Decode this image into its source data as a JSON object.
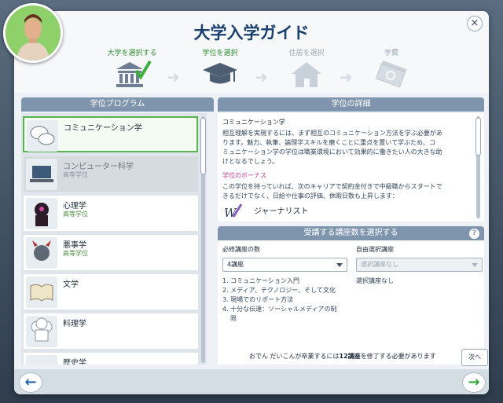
{
  "header": {
    "title": "大学入学ガイド",
    "close": "×"
  },
  "steps": [
    {
      "label": "大学を選択する",
      "state": "done"
    },
    {
      "label": "学位を選択",
      "state": "current"
    },
    {
      "label": "住居を選択",
      "state": "pending"
    },
    {
      "label": "学費",
      "state": "pending"
    }
  ],
  "degree_programs": {
    "heading": "学位プログラム",
    "items": [
      {
        "name": "コミュニケーション学",
        "sub": "",
        "icon": "speech-bubbles-icon"
      },
      {
        "name": "コンピューター科学",
        "sub": "高等学位",
        "icon": "laptop-icon"
      },
      {
        "name": "心理学",
        "sub": "高等学位",
        "icon": "head-silhouette-icon"
      },
      {
        "name": "悪事学",
        "sub": "高等学位",
        "icon": "devil-icon"
      },
      {
        "name": "文学",
        "sub": "",
        "icon": "book-icon"
      },
      {
        "name": "料理学",
        "sub": "",
        "icon": "chef-hat-icon"
      },
      {
        "name": "歴史学",
        "sub": "",
        "icon": "history-icon"
      }
    ]
  },
  "details": {
    "heading": "学位の詳細",
    "degree_name": "コミュニケーション学",
    "description_lines": [
      "相互理解を実現するには、まず相互のコミュニケーション方法を学ぶ必要があ",
      "ります。魅力、執筆、論理学スキルを磨くことに重点を置いて学ぶため、コ",
      "ミュニケーション学の学位は職業環境において効果的に働きたい人の大きな助",
      "けとなるでしょう。"
    ],
    "bonus_heading": "学位のボーナス",
    "bonus_lines": [
      "この学位を持っていれば、次のキャリアで契約金付きで中級職からスタートで",
      "きるだけでなく、日給や仕事の評価、休暇日数も上昇します："
    ],
    "career": "ジャーナリスト"
  },
  "course_select": {
    "heading": "受講する講座数を選択する",
    "help": "?",
    "required_label": "必修講座の数",
    "required_value": "4講座",
    "elective_label": "自由選択講座",
    "elective_value": "選択講座なし",
    "required_courses": [
      "1. コミュニケーション入門",
      "2. メディア、テクノロジー、そして文化",
      "3. 現場でのリポート方法",
      "4. 十分な伝達：ソーシャルメディアの制",
      "限"
    ],
    "elective_text": "選択講座なし",
    "footer_prefix": "おでん だいこんが卒業するには",
    "footer_count": "12講座",
    "footer_suffix": "を修了する必要があります"
  },
  "nav": {
    "back": "←",
    "next": "→",
    "next_tooltip": "次へ"
  }
}
